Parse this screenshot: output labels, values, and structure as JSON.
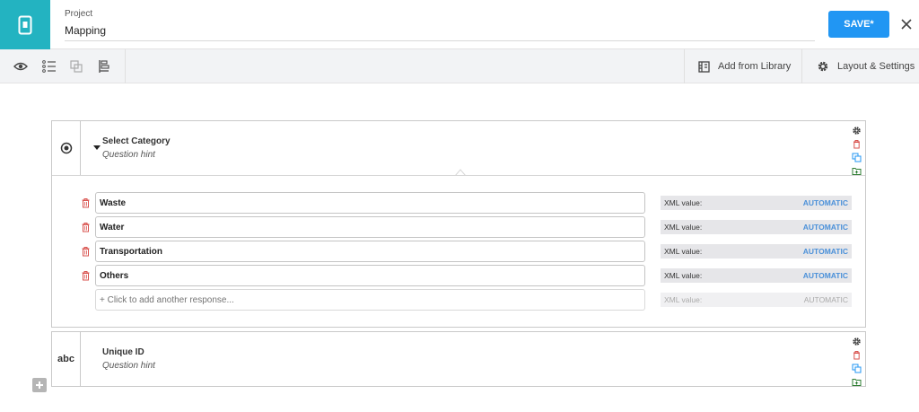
{
  "header": {
    "project_label": "Project",
    "project_name": "Mapping",
    "save_label": "SAVE*",
    "accent": "#23b3c1",
    "save_color": "#2196f3"
  },
  "toolbar": {
    "icons": [
      "eye-icon",
      "list-icon",
      "copy-groups-icon",
      "layout-icon"
    ],
    "add_from_library": "Add from Library",
    "layout_settings": "Layout & Settings"
  },
  "questions": [
    {
      "type_icon": "radio-icon",
      "title": "Select Category",
      "hint": "Question hint",
      "choices": [
        {
          "label": "Waste",
          "xml_label": "XML value:",
          "xml_value": "AUTOMATIC"
        },
        {
          "label": "Water",
          "xml_label": "XML value:",
          "xml_value": "AUTOMATIC"
        },
        {
          "label": "Transportation",
          "xml_label": "XML value:",
          "xml_value": "AUTOMATIC"
        },
        {
          "label": "Others",
          "xml_label": "XML value:",
          "xml_value": "AUTOMATIC"
        }
      ],
      "add_response": {
        "placeholder": "+ Click to add another response...",
        "xml_label": "XML value:",
        "xml_value": "AUTOMATIC"
      }
    },
    {
      "type_label": "abc",
      "title": "Unique ID",
      "hint": "Question hint"
    }
  ]
}
